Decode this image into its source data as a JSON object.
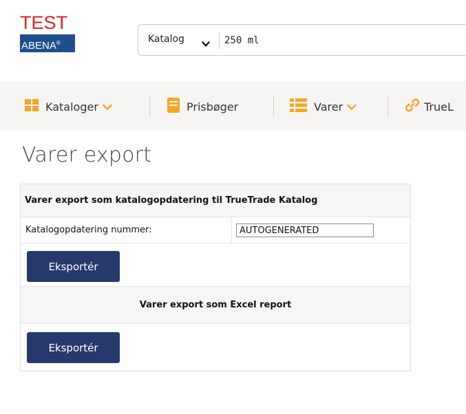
{
  "brand": {
    "test_label": "TEST",
    "company_label": "ABENA",
    "registered_mark": "®",
    "colors": {
      "test_red": "#e3201b",
      "abena_blue": "#1f4e8c"
    }
  },
  "search": {
    "scope_label": "Katalog",
    "scope_icon": "chevron-down-icon",
    "query_value": "250 ml"
  },
  "nav": {
    "items": [
      {
        "label": "Kataloger",
        "icon": "grid-icon",
        "has_dropdown": true
      },
      {
        "label": "Prisbøger",
        "icon": "book-icon",
        "has_dropdown": false
      },
      {
        "label": "Varer",
        "icon": "list-icon",
        "has_dropdown": true
      },
      {
        "label": "TrueL",
        "icon": "link-icon",
        "has_dropdown": false
      }
    ],
    "accent_color": "#f5a623"
  },
  "page": {
    "title": "Varer export"
  },
  "export_panel": {
    "catalog_section": {
      "heading": "Varer export som katalogopdatering til TrueTrade Katalog",
      "field_label": "Katalogopdatering nummer:",
      "field_value": "AUTOGENERATED",
      "button_label": "Eksportér"
    },
    "excel_section": {
      "heading": "Varer export som Excel report",
      "button_label": "Eksportér"
    },
    "button_color": "#253a6a"
  }
}
